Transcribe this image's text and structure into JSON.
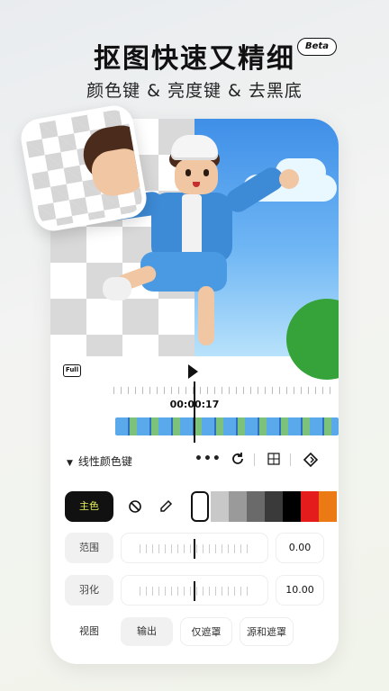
{
  "headline": "抠图快速又精细",
  "badge": "Beta",
  "subline": "颜色键 & 亮度键 & 去黑底",
  "player": {
    "full_label": "Full",
    "timecode": "00:00:17"
  },
  "keyer": {
    "toggle_icon": "▼",
    "label": "线性颜色键",
    "tools": [
      "more-icon",
      "reset-icon",
      "compare-icon",
      "keyframe-icon"
    ]
  },
  "color_picker": {
    "primary_label": "主色",
    "swatches": [
      "#ffffff",
      "#c8c8c8",
      "#9a9a9a",
      "#6a6a6a",
      "#3a3a3a",
      "#000000",
      "#e51c1c",
      "#ec7a14"
    ]
  },
  "params": [
    {
      "label": "范围",
      "value": "0.00"
    },
    {
      "label": "羽化",
      "value": "10.00"
    }
  ],
  "tabs": [
    {
      "label": "视图"
    },
    {
      "label": "输出"
    },
    {
      "label": "仅遮罩"
    },
    {
      "label": "源和遮罩"
    }
  ]
}
